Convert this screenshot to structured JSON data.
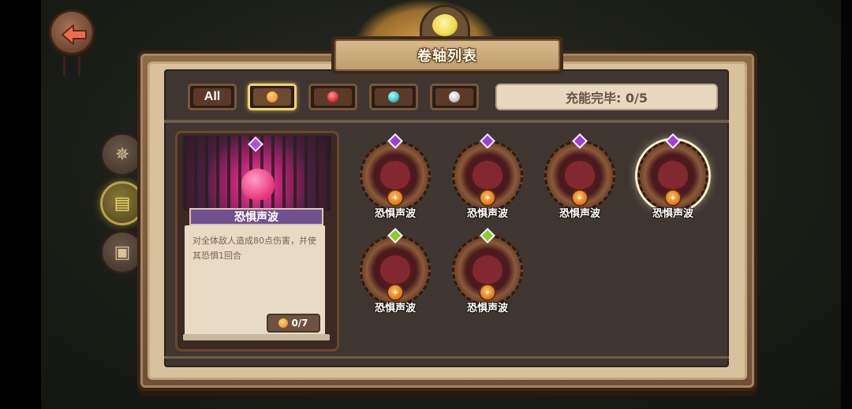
{
  "header": {
    "title": "卷轴列表"
  },
  "nav": {
    "back_icon": "back-arrow-icon"
  },
  "side_menu": [
    {
      "icon": "compass-icon",
      "active": false
    },
    {
      "icon": "scroll-icon",
      "active": true
    },
    {
      "icon": "box-icon",
      "active": false
    }
  ],
  "filters": {
    "all_label": "All",
    "selected": "fire",
    "elements": [
      {
        "id": "fire",
        "color": "#f0a23c"
      },
      {
        "id": "blood",
        "color": "#e0303a"
      },
      {
        "id": "water",
        "color": "#34c8d8"
      },
      {
        "id": "dark",
        "color": "#c8c8c8"
      }
    ]
  },
  "status": {
    "charge_text": "充能完毕: 0/5"
  },
  "detail": {
    "name": "恐惧声波",
    "description": "对全体敌人造成80点伤害，并使其恐惧1回合",
    "count": "0/7",
    "gem_color": "#b54bd8"
  },
  "scrolls": [
    {
      "name": "恐惧声波",
      "gem_color": "#a040d0",
      "selected": false
    },
    {
      "name": "恐惧声波",
      "gem_color": "#a040d0",
      "selected": false
    },
    {
      "name": "恐惧声波",
      "gem_color": "#a040d0",
      "selected": false
    },
    {
      "name": "恐惧声波",
      "gem_color": "#a040d0",
      "selected": true
    },
    {
      "name": "恐惧声波",
      "gem_color": "#8acc2a",
      "selected": false
    },
    {
      "name": "恐惧声波",
      "gem_color": "#8acc2a",
      "selected": false
    }
  ]
}
